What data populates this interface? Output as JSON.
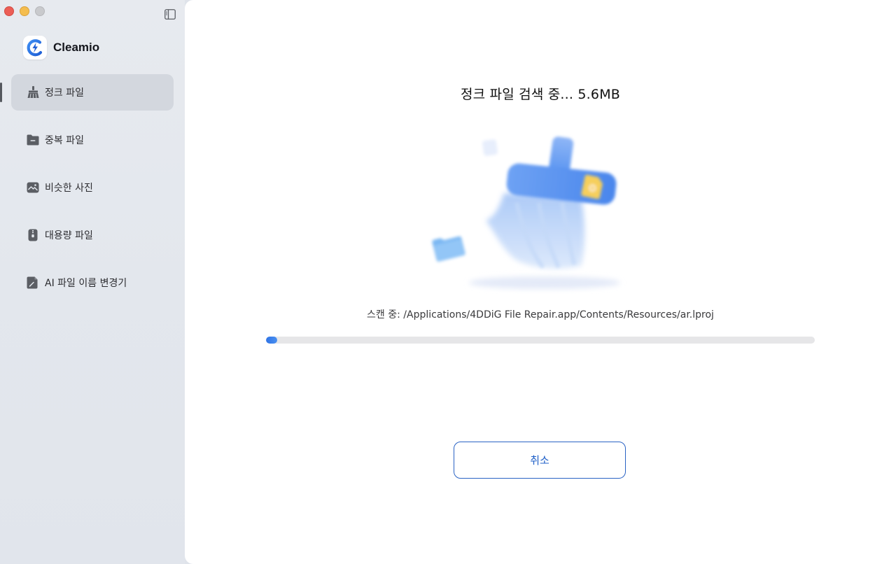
{
  "app": {
    "name": "Cleamio"
  },
  "sidebar": {
    "items": [
      {
        "label": "정크 파일",
        "icon": "broom-icon",
        "active": true
      },
      {
        "label": "중복 파일",
        "icon": "folder-icon",
        "active": false
      },
      {
        "label": "비슷한 사진",
        "icon": "photo-icon",
        "active": false
      },
      {
        "label": "대용량 파일",
        "icon": "archive-file-icon",
        "active": false
      },
      {
        "label": "AI 파일 이름 변경기",
        "icon": "rename-file-icon",
        "active": false
      }
    ]
  },
  "main": {
    "title": "정크 파일 검색 중... 5.6MB",
    "scan_path": "스캔 중: /Applications/4DDiG File Repair.app/Contents/Resources/ar.lproj",
    "progress": 0.02,
    "cancel_label": "취소"
  },
  "colors": {
    "accent": "#2f74e6",
    "sidebar_bg": "#e4e8ee",
    "active_item_bg": "#d3d7de"
  }
}
